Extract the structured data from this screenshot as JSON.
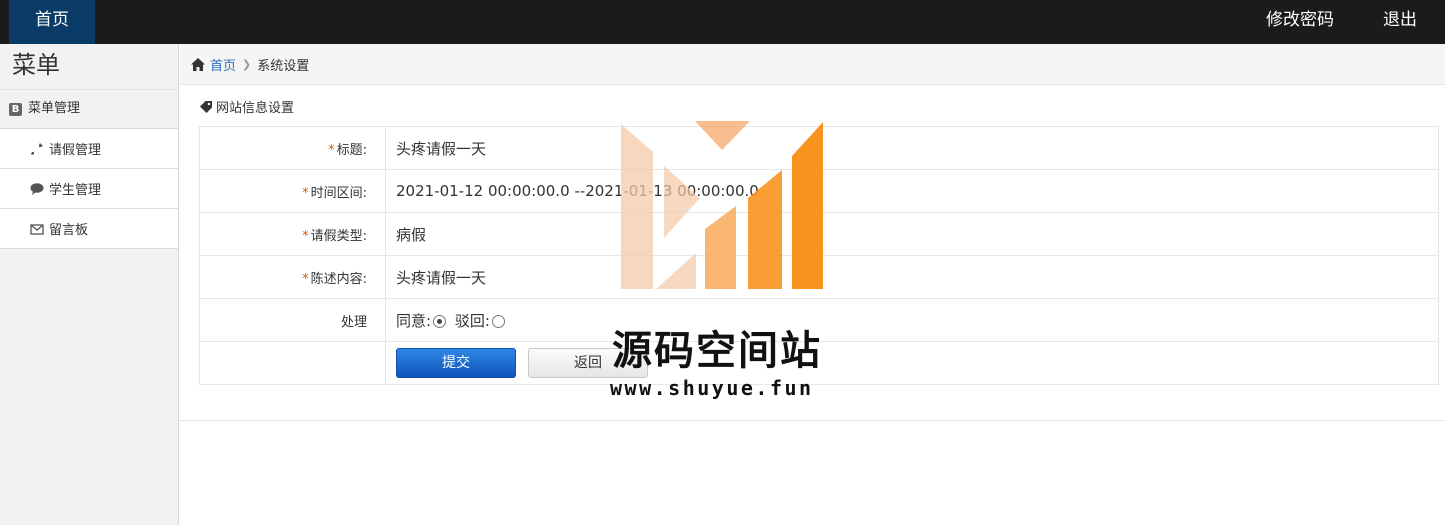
{
  "topbar": {
    "home_label": "首页",
    "change_password_label": "修改密码",
    "logout_label": "退出"
  },
  "sidebar": {
    "title": "菜单",
    "group_label": "菜单管理",
    "items": [
      {
        "label": "请假管理",
        "icon": "wrench-icon"
      },
      {
        "label": "学生管理",
        "icon": "comment-icon"
      },
      {
        "label": "留言板",
        "icon": "envelope-icon"
      }
    ]
  },
  "breadcrumb": {
    "home": "首页",
    "current": "系统设置"
  },
  "section_title": "网站信息设置",
  "form": {
    "title_label": "标题:",
    "title_value": "头疼请假一天",
    "time_label": "时间区间:",
    "time_value": "2021-01-12 00:00:00.0 --2021-01-13 00:00:00.0",
    "type_label": "请假类型:",
    "type_value": "病假",
    "content_label": "陈述内容:",
    "content_value": "头疼请假一天",
    "handle_label": "处理",
    "agree_label": "同意:",
    "reject_label": "驳回:",
    "selected": "agree",
    "submit_label": "提交",
    "back_label": "返回"
  },
  "watermark": {
    "name": "源码空间站",
    "url": "www.shuyue.fun",
    "colors": {
      "orange": "#f7931e",
      "light": "#f4c9a8"
    }
  }
}
